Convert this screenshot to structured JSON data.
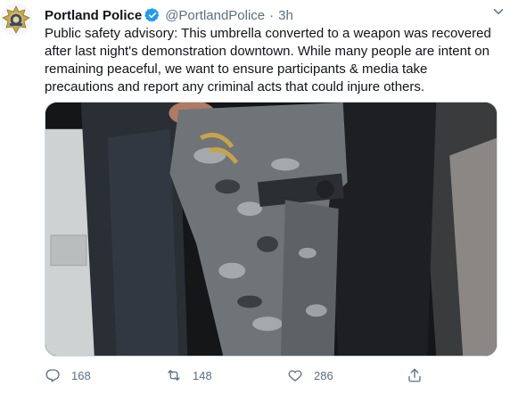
{
  "tweet": {
    "author_name": "Portland Police",
    "handle": "@PortlandPolice",
    "separator": "·",
    "time": "3h",
    "text": "Public safety advisory: This umbrella converted to a weapon was recovered after last night's demonstration downtown. While many people are intent on remaining peaceful, we want to ensure participants & media take precautions and report any criminal acts that could injure others."
  },
  "actions": {
    "replies": "168",
    "retweets": "148",
    "likes": "286"
  },
  "icons": {
    "avatar": "police-badge-icon",
    "verified": "verified-badge-icon",
    "menu": "chevron-down-icon",
    "reply": "reply-icon",
    "retweet": "retweet-icon",
    "like": "heart-icon",
    "share": "share-icon"
  },
  "colors": {
    "verified_blue": "#1d9bf0",
    "secondary_text": "#5b7083"
  }
}
